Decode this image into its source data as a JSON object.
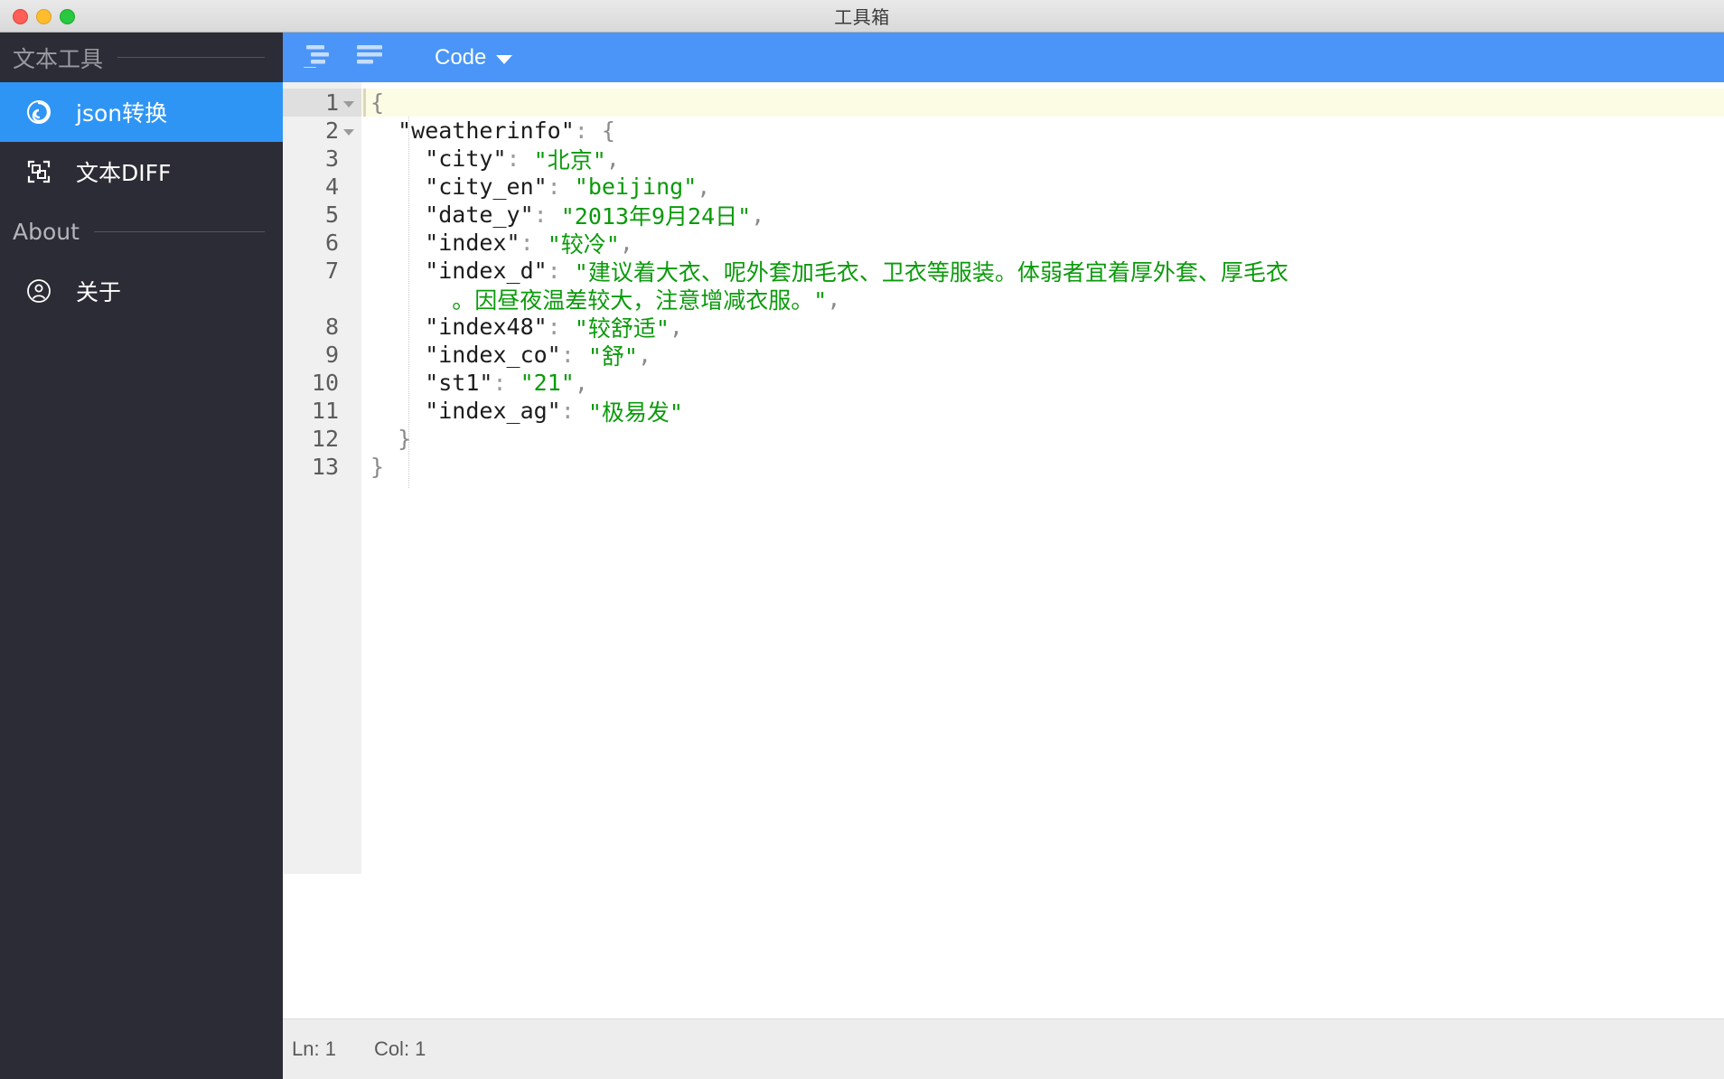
{
  "window": {
    "title": "工具箱",
    "traffic_lights": [
      "close-red",
      "minimize-yellow",
      "maximize-green"
    ]
  },
  "sidebar": {
    "header_title": "文本工具",
    "items": [
      {
        "label": "json转换",
        "icon": "json-convert-icon",
        "active": true
      },
      {
        "label": "文本DIFF",
        "icon": "diff-compare-icon",
        "active": false
      }
    ],
    "section": {
      "title": "About",
      "items": [
        {
          "label": "关于",
          "icon": "person-circle-icon",
          "active": false
        }
      ]
    },
    "colors": {
      "background": "#2c2c36",
      "active": "#2f95f5",
      "muted_text": "#9a9aa2"
    }
  },
  "toolbar": {
    "buttons": [
      {
        "name": "format-indent-icon",
        "label": ""
      },
      {
        "name": "format-compact-icon",
        "label": ""
      }
    ],
    "mode_select": {
      "label": "Code",
      "caret": "chevron-down-icon"
    },
    "accent_color": "#4a95f7"
  },
  "editor": {
    "active_line": 1,
    "fold_lines": [
      1,
      2
    ],
    "lines": [
      {
        "num": "1",
        "tokens": [
          {
            "t": "{",
            "c": "b"
          }
        ]
      },
      {
        "num": "2",
        "tokens": [
          {
            "t": "  \"weatherinfo\"",
            "c": "k"
          },
          {
            "t": ":",
            "c": "c"
          },
          {
            "t": " {",
            "c": "b"
          }
        ]
      },
      {
        "num": "3",
        "tokens": [
          {
            "t": "    \"city\"",
            "c": "k"
          },
          {
            "t": ":",
            "c": "c"
          },
          {
            "t": " ",
            "c": "k"
          },
          {
            "t": "\"北京\"",
            "c": "s"
          },
          {
            "t": ",",
            "c": "cm"
          }
        ]
      },
      {
        "num": "4",
        "tokens": [
          {
            "t": "    \"city_en\"",
            "c": "k"
          },
          {
            "t": ":",
            "c": "c"
          },
          {
            "t": " ",
            "c": "k"
          },
          {
            "t": "\"beijing\"",
            "c": "s"
          },
          {
            "t": ",",
            "c": "cm"
          }
        ]
      },
      {
        "num": "5",
        "tokens": [
          {
            "t": "    \"date_y\"",
            "c": "k"
          },
          {
            "t": ":",
            "c": "c"
          },
          {
            "t": " ",
            "c": "k"
          },
          {
            "t": "\"2013年9月24日\"",
            "c": "s"
          },
          {
            "t": ",",
            "c": "cm"
          }
        ]
      },
      {
        "num": "6",
        "tokens": [
          {
            "t": "    \"index\"",
            "c": "k"
          },
          {
            "t": ":",
            "c": "c"
          },
          {
            "t": " ",
            "c": "k"
          },
          {
            "t": "\"较冷\"",
            "c": "s"
          },
          {
            "t": ",",
            "c": "cm"
          }
        ]
      },
      {
        "num": "7",
        "tokens": [
          {
            "t": "    \"index_d\"",
            "c": "k"
          },
          {
            "t": ":",
            "c": "c"
          },
          {
            "t": " ",
            "c": "k"
          },
          {
            "t": "\"建议着大衣、呢外套加毛衣、卫衣等服装。体弱者宜着厚外套、厚毛衣",
            "c": "s"
          }
        ]
      },
      {
        "num": "",
        "wrapped": true,
        "tokens": [
          {
            "t": "      。因昼夜温差较大，注意增减衣服。\"",
            "c": "s"
          },
          {
            "t": ",",
            "c": "cm"
          }
        ]
      },
      {
        "num": "8",
        "tokens": [
          {
            "t": "    \"index48\"",
            "c": "k"
          },
          {
            "t": ":",
            "c": "c"
          },
          {
            "t": " ",
            "c": "k"
          },
          {
            "t": "\"较舒适\"",
            "c": "s"
          },
          {
            "t": ",",
            "c": "cm"
          }
        ]
      },
      {
        "num": "9",
        "tokens": [
          {
            "t": "    \"index_co\"",
            "c": "k"
          },
          {
            "t": ":",
            "c": "c"
          },
          {
            "t": " ",
            "c": "k"
          },
          {
            "t": "\"舒\"",
            "c": "s"
          },
          {
            "t": ",",
            "c": "cm"
          }
        ]
      },
      {
        "num": "10",
        "tokens": [
          {
            "t": "    \"st1\"",
            "c": "k"
          },
          {
            "t": ":",
            "c": "c"
          },
          {
            "t": " ",
            "c": "k"
          },
          {
            "t": "\"21\"",
            "c": "s"
          },
          {
            "t": ",",
            "c": "cm"
          }
        ]
      },
      {
        "num": "11",
        "tokens": [
          {
            "t": "    \"index_ag\"",
            "c": "k"
          },
          {
            "t": ":",
            "c": "c"
          },
          {
            "t": " ",
            "c": "k"
          },
          {
            "t": "\"极易发\"",
            "c": "s"
          }
        ]
      },
      {
        "num": "12",
        "tokens": [
          {
            "t": "  }",
            "c": "b"
          }
        ]
      },
      {
        "num": "13",
        "tokens": [
          {
            "t": "}",
            "c": "b"
          }
        ]
      }
    ],
    "colors": {
      "string": "#0b9a0b",
      "key": "#1c1c1c",
      "gutter_bg": "#f0f0f0",
      "active_line_bg": "#fcfbe3"
    }
  },
  "statusbar": {
    "line_label": "Ln: 1",
    "col_label": "Col: 1"
  }
}
